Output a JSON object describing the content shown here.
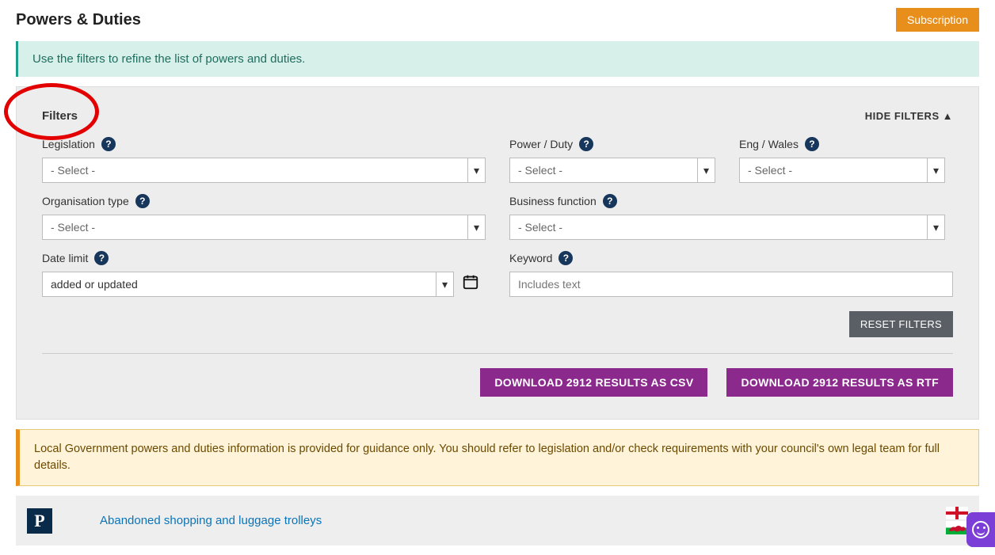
{
  "header": {
    "title": "Powers & Duties",
    "subscription": "Subscription"
  },
  "info": "Use the filters to refine the list of powers and duties.",
  "filters": {
    "title": "Filters",
    "hide": "HIDE FILTERS",
    "legislation": {
      "label": "Legislation",
      "value": "- Select -"
    },
    "power_duty": {
      "label": "Power / Duty",
      "value": "- Select -"
    },
    "eng_wales": {
      "label": "Eng / Wales",
      "value": "- Select -"
    },
    "org_type": {
      "label": "Organisation type",
      "value": "- Select -"
    },
    "bus_func": {
      "label": "Business function",
      "value": "- Select -"
    },
    "date_limit": {
      "label": "Date limit",
      "value": "added or updated"
    },
    "keyword": {
      "label": "Keyword",
      "placeholder": "Includes text"
    },
    "reset": "RESET FILTERS",
    "download_csv": "DOWNLOAD 2912 RESULTS AS CSV",
    "download_rtf": "DOWNLOAD 2912 RESULTS AS RTF"
  },
  "warn": "Local Government powers and duties information is provided for guidance only. You should refer to legislation and/or check requirements with your council's own legal team for full details.",
  "result": {
    "badge": "P",
    "title": "Abandoned shopping and luggage trolleys"
  }
}
